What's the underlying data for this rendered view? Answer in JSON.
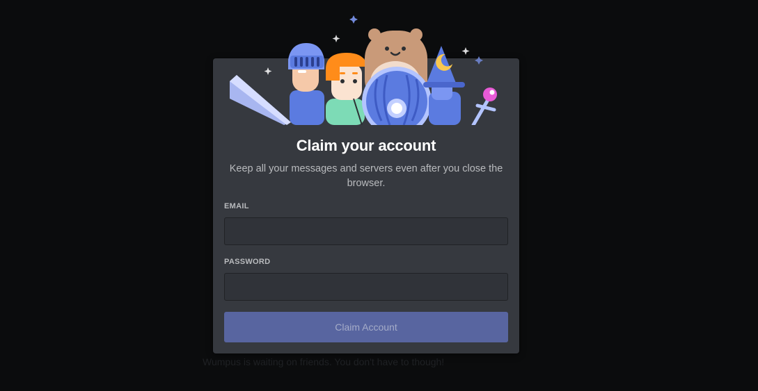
{
  "background": {
    "text": "Wumpus is waiting on friends. You don't have to though!"
  },
  "modal": {
    "title": "Claim your account",
    "subtitle": "Keep all your messages and servers even after you close the browser.",
    "email": {
      "label": "EMAIL",
      "value": ""
    },
    "password": {
      "label": "PASSWORD",
      "value": ""
    },
    "submit_label": "Claim Account"
  },
  "colors": {
    "modal_bg": "#36393f",
    "button_bg": "#5865a0",
    "input_bg": "#303339",
    "accent": "#7289da"
  }
}
